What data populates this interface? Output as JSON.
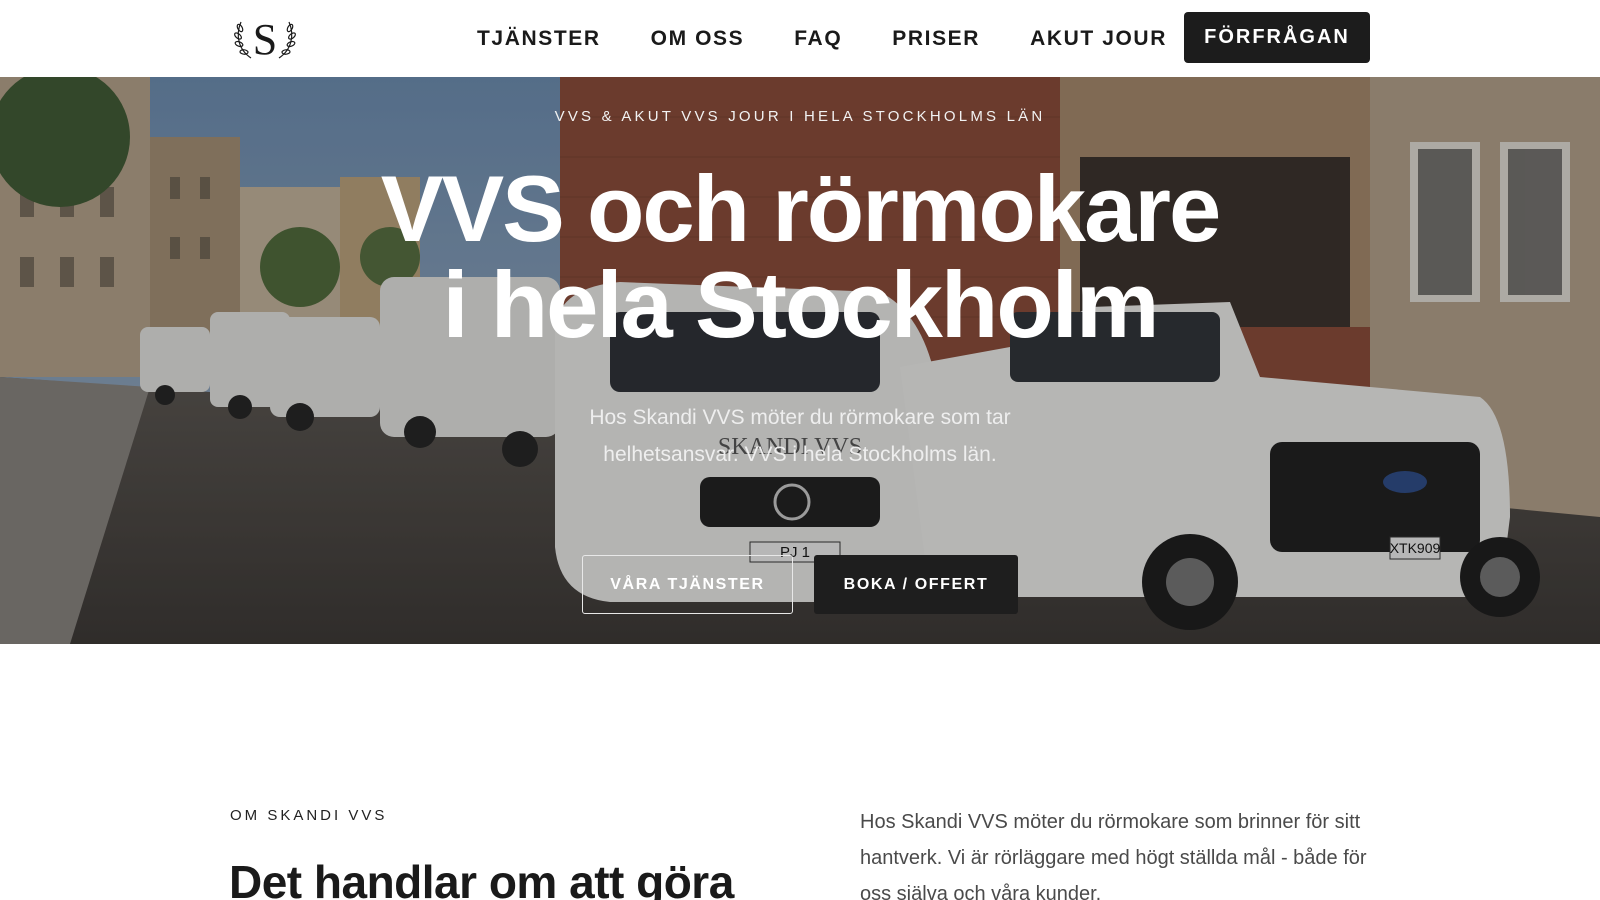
{
  "nav": {
    "logo_letter": "S",
    "links": [
      "TJÄNSTER",
      "OM OSS",
      "FAQ",
      "PRISER",
      "AKUT JOUR"
    ],
    "cta_label": "FÖRFRÅGAN"
  },
  "hero": {
    "eyebrow": "VVS & AKUT VVS JOUR I HELA STOCKHOLMS LÄN",
    "title_line1": "VVS och rörmokare",
    "title_line2": "i hela Stockholm",
    "subtitle": "Hos Skandi VVS möter du rörmokare som tar helhetsansvar. VVS i hela Stockholms län.",
    "primary_button": "VÅRA TJÄNSTER",
    "secondary_button": "BOKA / OFFERT",
    "van_brand": "SKANDI VVS",
    "plate_1": "PJ 1",
    "plate_2": "XTK909"
  },
  "about": {
    "eyebrow": "OM SKANDI VVS",
    "heading": "Det handlar om att göra",
    "text": "Hos Skandi VVS möter du rörmokare som brinner för sitt hantverk. Vi är rörläggare med högt ställda mål - både för oss själva och våra kunder."
  },
  "colors": {
    "dark_button": "#1c1c1c",
    "text": "#1a1a1a",
    "body_text": "#4a4a4a"
  }
}
